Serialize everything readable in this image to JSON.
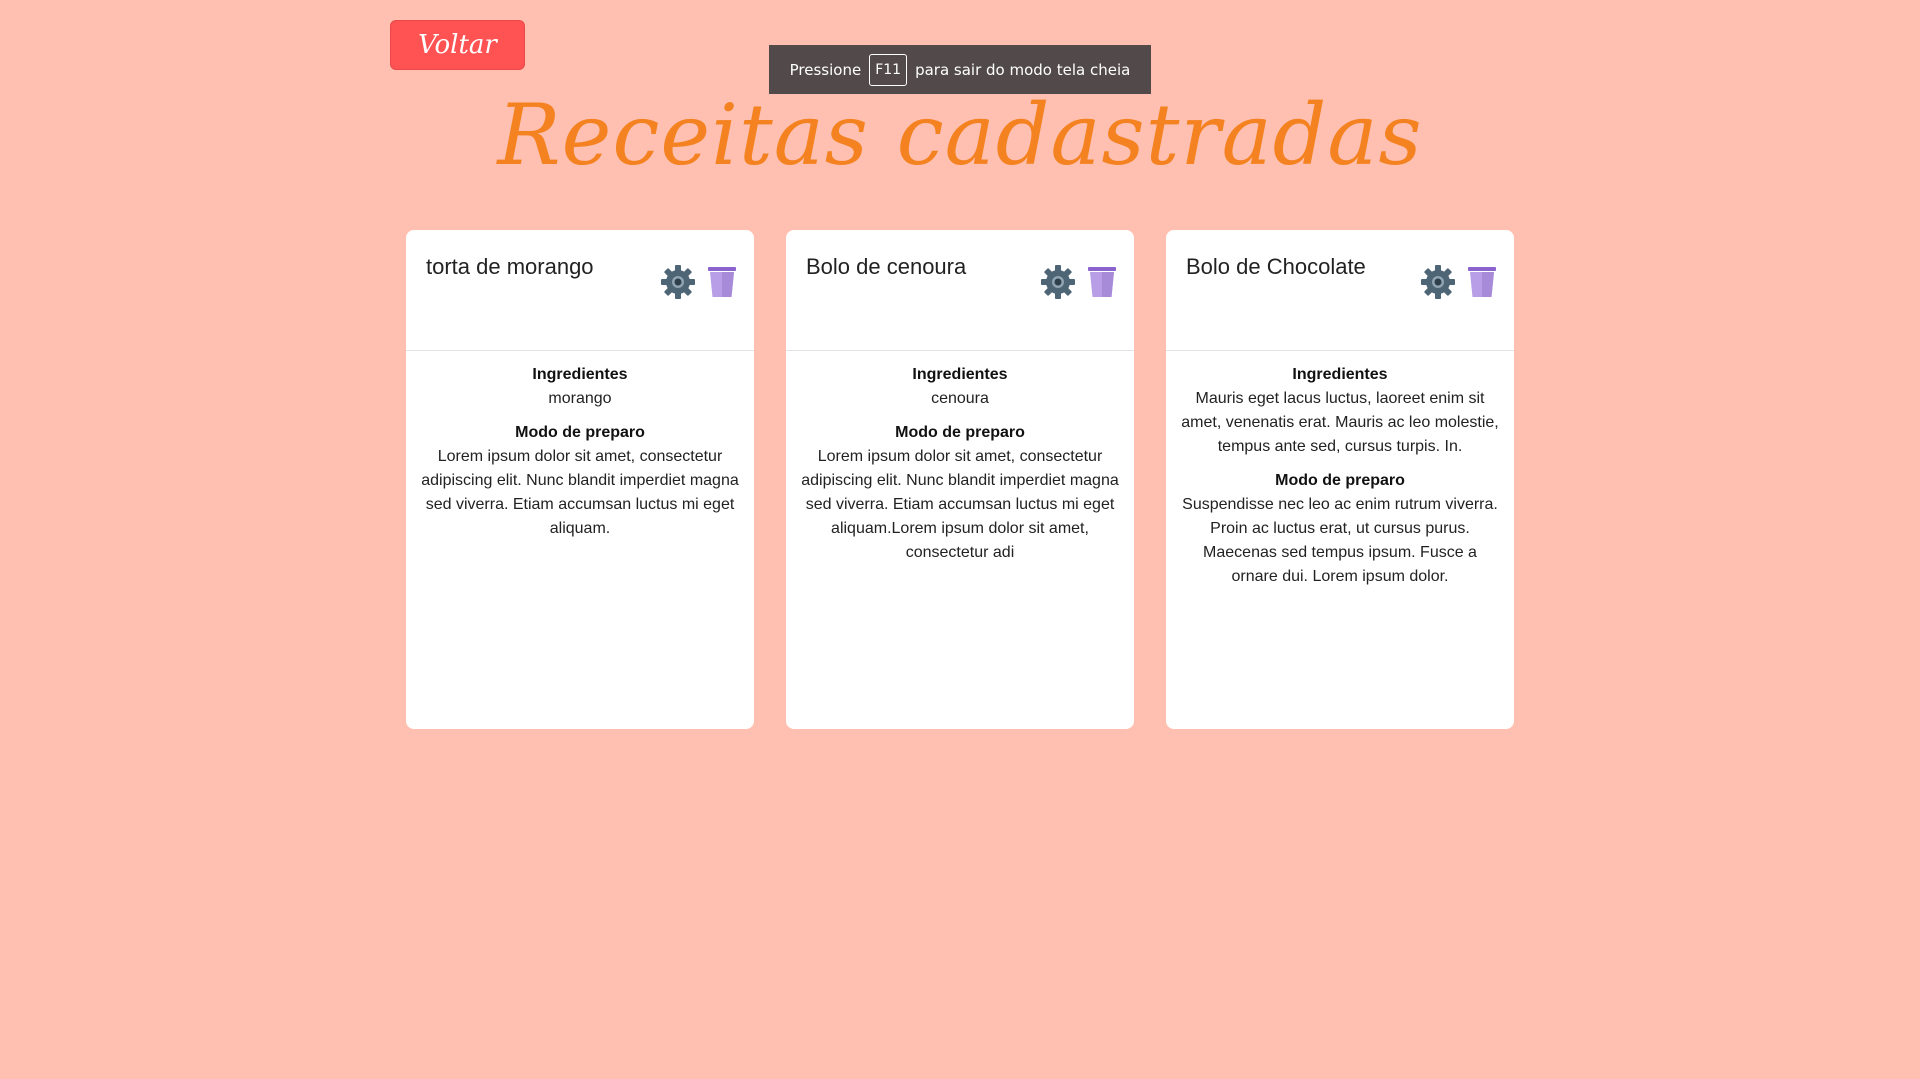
{
  "header": {
    "back_label": "Voltar",
    "title": "Receitas cadastradas"
  },
  "fullscreen_notice": {
    "prefix": "Pressione",
    "key": "F11",
    "suffix": "para sair do modo tela cheia"
  },
  "labels": {
    "ingredients": "Ingredientes",
    "preparation": "Modo de preparo"
  },
  "icons": {
    "edit": "gear-icon",
    "delete": "trash-icon"
  },
  "colors": {
    "background": "#ffc0b1",
    "back_button": "#ff5252",
    "title": "#f58220",
    "gear": "#4e6575",
    "trash": "#a78bd9"
  },
  "recipes": [
    {
      "name": "torta de morango",
      "ingredients": "morango",
      "preparation": "Lorem ipsum dolor sit amet, consectetur adipiscing elit. Nunc blandit imperdiet magna sed viverra. Etiam accumsan luctus mi eget aliquam."
    },
    {
      "name": "Bolo de cenoura",
      "ingredients": "cenoura",
      "preparation": "Lorem ipsum dolor sit amet, consectetur adipiscing elit. Nunc blandit imperdiet magna sed viverra. Etiam accumsan luctus mi eget aliquam.Lorem ipsum dolor sit amet, consectetur adi"
    },
    {
      "name": "Bolo de Chocolate",
      "ingredients": "Mauris eget lacus luctus, laoreet enim sit amet, venenatis erat. Mauris ac leo molestie, tempus ante sed, cursus turpis. In.",
      "preparation": "Suspendisse nec leo ac enim rutrum viverra. Proin ac luctus erat, ut cursus purus. Maecenas sed tempus ipsum. Fusce a ornare dui. Lorem ipsum dolor."
    }
  ]
}
